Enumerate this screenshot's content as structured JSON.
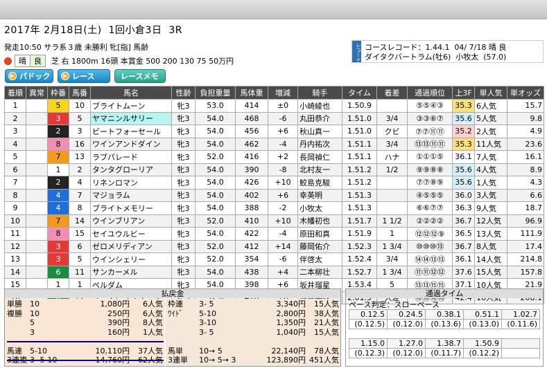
{
  "header": {
    "title": "2017年 2月18日(土)  1回小倉3日  3R",
    "line1": "発走10:50 サラ系３歳 未勝利 牝[指] 馬齢",
    "weather": "晴",
    "track_condition": "良",
    "line2": "芝 右 1800m 16頭 本賞金 500 200 130 75 50万円"
  },
  "record": {
    "tag": "レコード",
    "line1": "コースレコード：1.44.1  04/ 7/18 晴 良",
    "line2": "ダイタクバートラム(牡6)  小牧太  (57.0)"
  },
  "buttons": {
    "paddock": "パドック",
    "race": "レース",
    "memo": "レースメモ"
  },
  "columns": [
    "着順",
    "異常",
    "枠番",
    "馬番",
    "馬名",
    "性齢",
    "負担重量",
    "馬体重",
    "増減",
    "騎手",
    "タイム",
    "着差",
    "通過順位",
    "上3F",
    "単人気",
    "単オッズ"
  ],
  "rows": [
    {
      "pos": "1",
      "ab": "",
      "waku": "5",
      "num": "10",
      "name": "ブライトムーン",
      "sex": "牝3",
      "wt": "53.0",
      "bw": "414",
      "diff": "±0",
      "jockey": "小崎綾也",
      "time": "1.50.9",
      "margin": "",
      "pass": "⑤⑤④③",
      "f3": "35.3",
      "pop": "6人気",
      "odds": "15.7"
    },
    {
      "pos": "2",
      "ab": "",
      "waku": "3",
      "num": "5",
      "name": "ヤマニンルサリー",
      "sex": "牝3",
      "wt": "54.0",
      "bw": "468",
      "diff": "-6",
      "jockey": "丸田恭介",
      "time": "1.51.0",
      "margin": "3/4",
      "pass": "③③⑥⑦",
      "f3": "35.6",
      "pop": "5人気",
      "odds": "9.8"
    },
    {
      "pos": "3",
      "ab": "",
      "waku": "2",
      "num": "3",
      "name": "ビートフォーセール",
      "sex": "牝3",
      "wt": "54.0",
      "bw": "456",
      "diff": "+6",
      "jockey": "秋山真一",
      "time": "1.51.0",
      "margin": "クビ",
      "pass": "⑦⑦⑪⑪",
      "f3": "35.2",
      "pop": "2人気",
      "odds": "4.9"
    },
    {
      "pos": "4",
      "ab": "",
      "waku": "8",
      "num": "16",
      "name": "ワインアンドダイン",
      "sex": "牝3",
      "wt": "54.0",
      "bw": "462",
      "diff": "-4",
      "jockey": "丹内祐次",
      "time": "1.51.1",
      "margin": "3/4",
      "pass": "⑬⑬⑪⑪",
      "f3": "35.3",
      "pop": "11人気",
      "odds": "23.6"
    },
    {
      "pos": "5",
      "ab": "",
      "waku": "7",
      "num": "13",
      "name": "ラブパレード",
      "sex": "牝3",
      "wt": "52.0",
      "bw": "416",
      "diff": "+2",
      "jockey": "長岡禎仁",
      "time": "1.51.1",
      "margin": "ハナ",
      "pass": "①①①⑤",
      "f3": "36.1",
      "pop": "7人気",
      "odds": "16.1"
    },
    {
      "pos": "6",
      "ab": "",
      "waku": "1",
      "num": "2",
      "name": "タンタグローリア",
      "sex": "牝3",
      "wt": "54.0",
      "bw": "390",
      "diff": "-8",
      "jockey": "北村友一",
      "time": "1.51.2",
      "margin": "1/2",
      "pass": "⑨⑨⑧⑧",
      "f3": "35.6",
      "pop": "4人気",
      "odds": "8.9"
    },
    {
      "pos": "7",
      "ab": "",
      "waku": "2",
      "num": "4",
      "name": "リネンロマン",
      "sex": "牝3",
      "wt": "54.0",
      "bw": "426",
      "diff": "+10",
      "jockey": "鮫島克駿",
      "time": "1.51.2",
      "margin": "",
      "pass": "⑦⑦⑧⑨",
      "f3": "35.6",
      "pop": "1人気",
      "odds": "4.3"
    },
    {
      "pos": "8",
      "ab": "",
      "waku": "4",
      "num": "7",
      "name": "マジョラム",
      "sex": "牝3",
      "wt": "54.0",
      "bw": "402",
      "diff": "+6",
      "jockey": "幸英明",
      "time": "1.51.3",
      "margin": "",
      "pass": "④⑤⑤⑤",
      "f3": "36.0",
      "pop": "3人気",
      "odds": "6.6"
    },
    {
      "pos": "9",
      "ab": "",
      "waku": "4",
      "num": "8",
      "name": "ブライトメモリー",
      "sex": "牝3",
      "wt": "54.0",
      "bw": "388",
      "diff": "-2",
      "jockey": "小牧太",
      "time": "1.51.3",
      "margin": "",
      "pass": "⑥⑥⑦⑦",
      "f3": "36.3",
      "pop": "9人気",
      "odds": "18.7"
    },
    {
      "pos": "10",
      "ab": "",
      "waku": "7",
      "num": "14",
      "name": "ウインブリアン",
      "sex": "牝3",
      "wt": "52.0",
      "bw": "410",
      "diff": "+10",
      "jockey": "木幡初也",
      "time": "1.51.7",
      "margin": "1 1/2",
      "pass": "②②②②",
      "f3": "36.7",
      "pop": "12人気",
      "odds": "96.9"
    },
    {
      "pos": "11",
      "ab": "",
      "waku": "8",
      "num": "15",
      "name": "セイユウルビー",
      "sex": "牝3",
      "wt": "54.0",
      "bw": "422",
      "diff": "-4",
      "jockey": "原田和真",
      "time": "1.51.9",
      "margin": "1",
      "pass": "⑫⑫⑫⑨",
      "f3": "36.5",
      "pop": "13人気",
      "odds": "111.9"
    },
    {
      "pos": "12",
      "ab": "",
      "waku": "3",
      "num": "6",
      "name": "ゼロメリディアン",
      "sex": "牝3",
      "wt": "52.0",
      "bw": "412",
      "diff": "+14",
      "jockey": "藤岡佑介",
      "time": "1.52.3",
      "margin": "1 3/4",
      "pass": "⑩⑩⑩⑬",
      "f3": "36.7",
      "pop": "8人気",
      "odds": "17.4"
    },
    {
      "pos": "13",
      "ab": "",
      "waku": "3",
      "num": "5",
      "name": "ウインシェリー",
      "sex": "牝3",
      "wt": "52.0",
      "bw": "354",
      "diff": "-6",
      "jockey": "伴啓太",
      "time": "1.52.4",
      "margin": "3/4",
      "pass": "⑭⑭⑬⑬",
      "f3": "36.1",
      "pop": "14人気",
      "odds": "214.8"
    },
    {
      "pos": "14",
      "ab": "",
      "waku": "6",
      "num": "11",
      "name": "サンカーメル",
      "sex": "牝3",
      "wt": "54.0",
      "bw": "438",
      "diff": "+4",
      "jockey": "二本柳壮",
      "time": "1.52.7",
      "margin": "1 3/4",
      "pass": "⑪⑪⑫⑫",
      "f3": "37.6",
      "pop": "15人気",
      "odds": "157.8"
    },
    {
      "pos": "15",
      "ab": "",
      "waku": "1",
      "num": "1",
      "name": "ペルダム",
      "sex": "牝3",
      "wt": "54.0",
      "bw": "398",
      "diff": "+6",
      "jockey": "坂井瑠星",
      "time": "1.53.4",
      "margin": "5",
      "pass": "⑬⑬⑮⑮",
      "f3": "37.1",
      "pop": "10人気",
      "odds": "21.9"
    },
    {
      "pos": "16",
      "ab": "",
      "waku": "6",
      "num": "12",
      "name": "ユミノビッグブーツ",
      "sex": "牝3",
      "wt": "52.0",
      "bw": "478",
      "diff": "+8",
      "jockey": "城戸義政",
      "time": "2.01.5",
      "margin": "大差",
      "pass": "⑯⑯⑯⑯",
      "f3": "42.4",
      "pop": "16人気",
      "odds": "208.1"
    }
  ],
  "payout": {
    "title": "払戻金",
    "left": [
      {
        "kind": "単勝",
        "combo": "10",
        "amount": "1,080円",
        "pop": "6人気"
      },
      {
        "kind": "複勝",
        "combo": "10",
        "amount": "250円",
        "pop": "6人気"
      },
      {
        "kind": "",
        "combo": "5",
        "amount": "390円",
        "pop": "8人気"
      },
      {
        "kind": "",
        "combo": "3",
        "amount": "160円",
        "pop": "1人気"
      },
      {
        "kind": "",
        "combo": "",
        "amount": "",
        "pop": ""
      },
      {
        "kind": "馬連",
        "combo": "5-10",
        "amount": "10,110円",
        "pop": "37人気"
      },
      {
        "kind": "3連複",
        "combo": "3- 5-10",
        "amount": "14,760円",
        "pop": "62人気"
      }
    ],
    "right": [
      {
        "kind": "枠連",
        "combo": "3- 5",
        "amount": "3,340円",
        "pop": "15人気"
      },
      {
        "kind": "ﾜｲﾄﾞ",
        "combo": "5-10",
        "amount": "2,800円",
        "pop": "38人気"
      },
      {
        "kind": "",
        "combo": "3-10",
        "amount": "1,350円",
        "pop": "21人気"
      },
      {
        "kind": "",
        "combo": "3- 5",
        "amount": "1,040円",
        "pop": "15人気"
      },
      {
        "kind": "",
        "combo": "",
        "amount": "",
        "pop": ""
      },
      {
        "kind": "馬単",
        "combo": "10→ 5",
        "amount": "22,140円",
        "pop": "78人気"
      },
      {
        "kind": "3連単",
        "combo": "10→ 5→ 3",
        "amount": "123,890円",
        "pop": "451人気"
      }
    ]
  },
  "times": {
    "title": "通過タイム",
    "pace": "ペース判定：スローペース",
    "row1": [
      "0.12.5",
      "0.24.5",
      "0.38.1",
      "0.51.1",
      "1.02.7"
    ],
    "row2": [
      "(0.12.5)",
      "(0.12.0)",
      "(0.13.6)",
      "(0.13.0)",
      "(0.11.6)"
    ],
    "row3": [
      "1.15.0",
      "1.27.0",
      "1.38.7",
      "1.50.9",
      ""
    ],
    "row4": [
      "(0.12.3)",
      "(0.12.0)",
      "(0.11.7)",
      "(0.12.2)",
      ""
    ]
  }
}
